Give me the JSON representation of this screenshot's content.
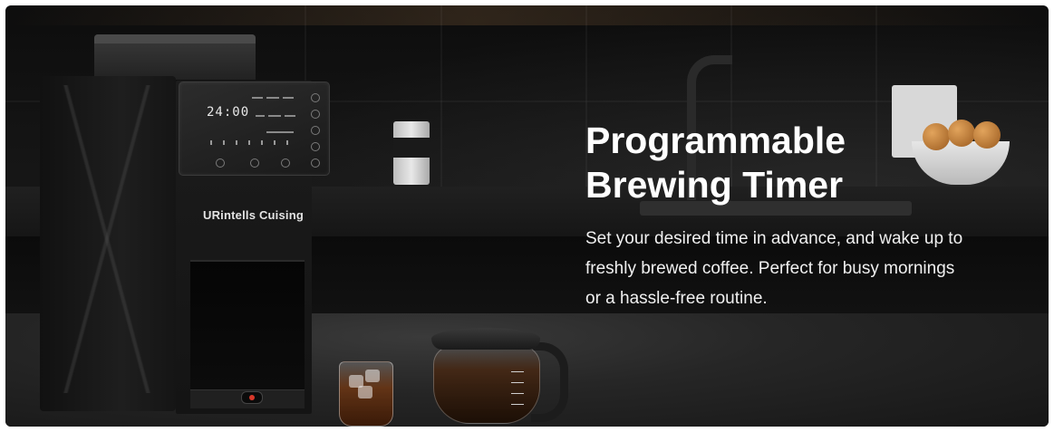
{
  "banner": {
    "headline_line1": "Programmable",
    "headline_line2": "Brewing Timer",
    "body": "Set your desired time in advance, and wake up to freshly brewed coffee. Perfect for busy mornings or a hassle-free routine."
  },
  "product": {
    "brand": "URintells Cuising",
    "display_time": "24:00"
  },
  "colors": {
    "background": "#161616",
    "headline": "#ffffff",
    "body_text": "#f0f0f0",
    "power_light": "#d8382a"
  }
}
